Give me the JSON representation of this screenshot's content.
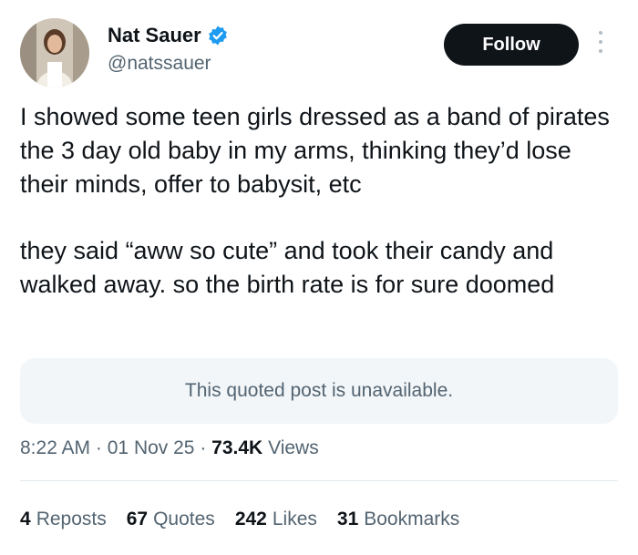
{
  "author": {
    "name": "Nat Sauer",
    "handle": "@natssauer",
    "verified_color": "#1d9bf0"
  },
  "actions": {
    "follow_label": "Follow"
  },
  "post": {
    "paragraphs": [
      "I showed some teen girls dressed as a band of pirates the 3 day old baby in my arms, thinking they’d lose their minds, offer to babysit, etc",
      "they said “aww so cute” and took their candy and walked away. so the birth rate is for sure doomed"
    ],
    "quoted_post": "This quoted post is unavailable."
  },
  "meta": {
    "time": "8:22 AM",
    "date": "01 Nov 25",
    "views_count": "73.4K",
    "views_label": "Views",
    "separator": "·"
  },
  "stats": [
    {
      "count": "4",
      "label": "Reposts"
    },
    {
      "count": "67",
      "label": "Quotes"
    },
    {
      "count": "242",
      "label": "Likes"
    },
    {
      "count": "31",
      "label": "Bookmarks"
    }
  ],
  "colors": {
    "text": "#0f1419",
    "secondary_text": "#536471",
    "follow_bg": "#0f1419",
    "quote_bg": "#f2f6f9"
  }
}
